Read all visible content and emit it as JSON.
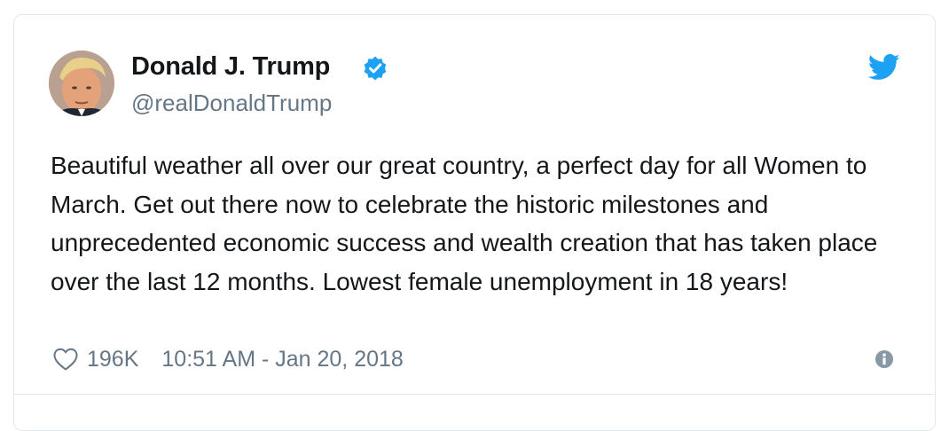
{
  "tweet": {
    "author_name": "Donald J. Trump",
    "handle": "@realDonaldTrump",
    "verified": true,
    "text": "Beautiful weather all over our great country, a perfect day for all Women to March. Get out there now to celebrate the historic milestones and unprecedented economic success and wealth creation that has taken place over the last 12 months. Lowest female unemployment in 18 years!",
    "likes": "196K",
    "timestamp": "10:51 AM - Jan 20, 2018"
  },
  "icons": {
    "verified": "verified-badge-icon",
    "brand": "twitter-bird-icon",
    "like": "heart-icon",
    "info": "info-icon"
  },
  "colors": {
    "twitter_blue": "#1da1f2",
    "text_primary": "#14171a",
    "text_secondary": "#657786",
    "border": "#e1e8ed"
  }
}
